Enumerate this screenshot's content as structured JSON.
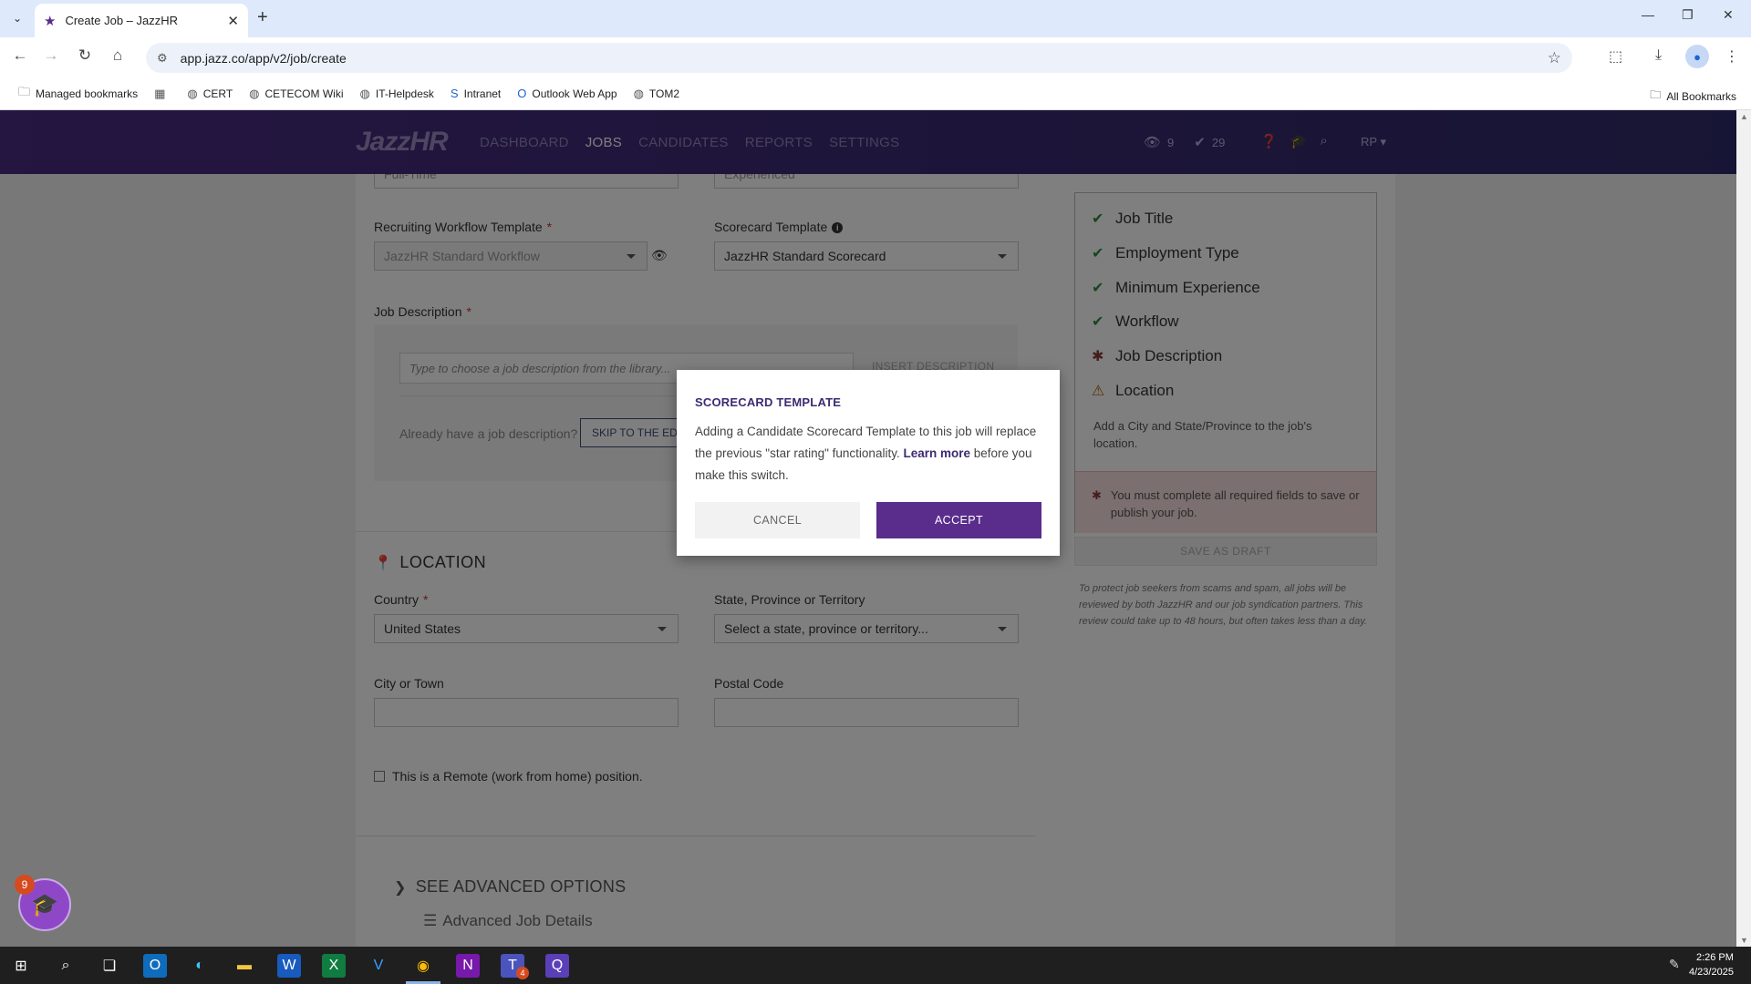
{
  "browser": {
    "tab_title": "Create Job – JazzHR",
    "url": "app.jazz.co/app/v2/job/create",
    "bookmarks": [
      "Managed bookmarks",
      "CERT",
      "CETECOM Wiki",
      "IT-Helpdesk",
      "Intranet",
      "Outlook Web App",
      "TOM2"
    ],
    "all_bookmarks": "All Bookmarks",
    "profile_initial": "●"
  },
  "header": {
    "logo": "JazzHR",
    "nav": [
      "DASHBOARD",
      "JOBS",
      "CANDIDATES",
      "REPORTS",
      "SETTINGS"
    ],
    "active_nav": "JOBS",
    "views_count": "9",
    "approvals_count": "29",
    "user_initials": "RP"
  },
  "form": {
    "employment_type_value": "Full-Time",
    "experience_value": "Experienced",
    "workflow_label": "Recruiting Workflow Template",
    "workflow_value": "JazzHR Standard Workflow",
    "scorecard_label": "Scorecard Template",
    "scorecard_value": "JazzHR Standard Scorecard",
    "job_description_label": "Job Description",
    "library_placeholder": "Type to choose a job description from the library...",
    "insert_description": "INSERT DESCRIPTION",
    "already_have": "Already have a job description?",
    "skip_button": "SKIP TO THE EDITOR",
    "location_title": "LOCATION",
    "country_label": "Country",
    "country_value": "United States",
    "state_label": "State, Province or Territory",
    "state_value": "Select a state, province or territory...",
    "city_label": "City or Town",
    "postal_label": "Postal Code",
    "remote_label": "This is a Remote (work from home) position.",
    "advanced_options": "SEE ADVANCED OPTIONS",
    "advanced_job_details": "Advanced Job Details"
  },
  "checklist": {
    "items": [
      {
        "label": "Job Title",
        "status": "ok"
      },
      {
        "label": "Employment Type",
        "status": "ok"
      },
      {
        "label": "Minimum Experience",
        "status": "ok"
      },
      {
        "label": "Workflow",
        "status": "ok"
      },
      {
        "label": "Job Description",
        "status": "pending"
      },
      {
        "label": "Location",
        "status": "warn"
      }
    ],
    "location_note": "Add a City and State/Province to the job's location.",
    "alert": "You must complete all required fields to save or publish your job.",
    "save_draft": "SAVE AS DRAFT",
    "legal": "To protect job seekers from scams and spam, all jobs will be reviewed by both JazzHR and our job syndication partners. This review could take up to 48 hours, but often takes less than a day."
  },
  "modal": {
    "title": "SCORECARD TEMPLATE",
    "body_before": "Adding a Candidate Scorecard Template to this job will replace the previous \"star rating\" functionality. ",
    "learn_more": "Learn more",
    "body_after": " before you make this switch.",
    "cancel": "CANCEL",
    "accept": "ACCEPT"
  },
  "learning_badge": "9",
  "taskbar": {
    "time": "2:26 PM",
    "date": "4/23/2025",
    "teams_badge": "4"
  },
  "colors": {
    "brand_purple": "#5a2d8c",
    "header_gradient_start": "#4a2a82",
    "ok_green": "#2e8b3e",
    "alert_bg": "#f7dede"
  }
}
